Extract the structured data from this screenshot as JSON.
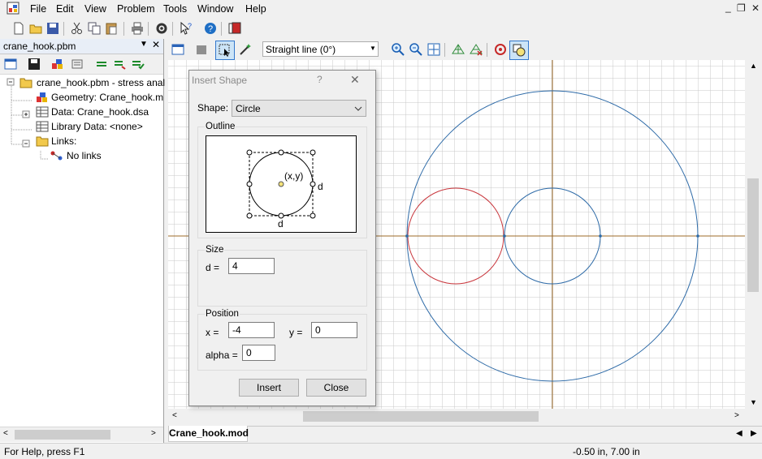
{
  "menu": [
    "File",
    "Edit",
    "View",
    "Problem",
    "Tools",
    "Window",
    "Help"
  ],
  "panel": {
    "title": "crane_hook.pbm",
    "tree": {
      "root": "crane_hook.pbm - stress anal",
      "geometry": "Geometry: Crane_hook.m",
      "data": "Data: Crane_hook.dsa",
      "library": "Library Data: <none>",
      "links": "Links:",
      "no_links": "No links"
    }
  },
  "view_toolbar": {
    "line_mode": "Straight line (0°)"
  },
  "dialog": {
    "title": "Insert Shape",
    "help": "?",
    "close_x": "✕",
    "shape_label": "Shape:",
    "shape_value": "Circle",
    "outline_label": "Outline",
    "preview_center": "(x,y)",
    "preview_d_right": "d",
    "preview_d_bottom": "d",
    "size_label": "Size",
    "d_label": "d =",
    "d_value": "4",
    "position_label": "Position",
    "x_label": "x =",
    "x_value": "-4",
    "y_label": "y =",
    "y_value": "0",
    "alpha_label": "alpha =",
    "alpha_value": "0",
    "insert_btn": "Insert",
    "close_btn": "Close"
  },
  "tab": "Crane_hook.mod",
  "status": {
    "help": "For Help, press F1",
    "coords": "-0.50 in, 7.00 in"
  },
  "colors": {
    "axis": "#9c6b2a",
    "blue_circle": "#2d6aa7",
    "red_circle": "#c8353b",
    "grid": "#c8c8c8"
  }
}
